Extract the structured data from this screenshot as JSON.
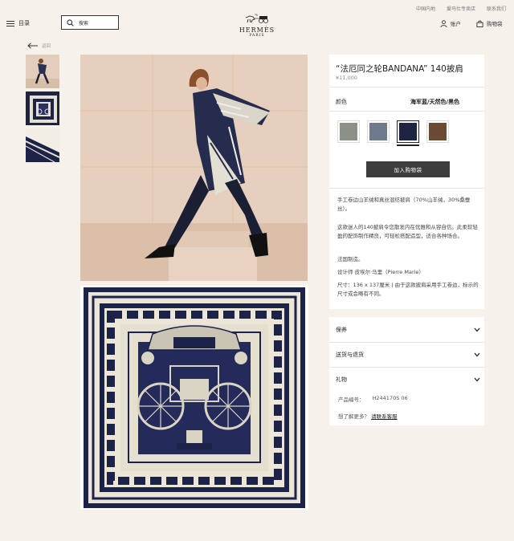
{
  "top_links": [
    "中国内地",
    "爱马仕专卖店",
    "联系我们"
  ],
  "header": {
    "menu_label": "目录",
    "search_placeholder": "搜索",
    "logo_name": "HERMÈS",
    "logo_city": "PARIS",
    "account_label": "账户",
    "cart_label": "购物袋"
  },
  "nav": {
    "back_label": "返回"
  },
  "product": {
    "title": "“法厄同之轮BANDANA” 140披肩",
    "price": "¥11,000",
    "color_label": "颜色",
    "color_value": "海军蓝/天然色/黑色",
    "swatches": [
      {
        "name": "grey-green",
        "color": "#8c9187"
      },
      {
        "name": "blue-grey",
        "color": "#6e7a8c"
      },
      {
        "name": "navy-natural-black",
        "color": "#1f2540"
      },
      {
        "name": "brown",
        "color": "#6b4a34"
      }
    ],
    "add_to_bag": "加入购物袋",
    "description": [
      "手工卷边山羊绒和真丝混纺披肩（70%山羊绒，30%桑蚕丝）。",
      "这款迷人的140披肩令您散发内在优雅和从容自信。此柔软轻盈的配饰制作精良，可轻松搭配造型，适合各种场合。",
      "法国制造。",
      "设计师 皮埃尔·马里（Pierre Marie）",
      "尺寸：136 x 137厘米 | 由于这款披肩采用手工卷边，标示的尺寸或会略有不同。"
    ]
  },
  "accordions": [
    "保养",
    "送货与退货",
    "礼物"
  ],
  "product_number_label": "产品编号：",
  "product_number": "H244170S 06",
  "contact_prefix": "想了解更多？",
  "contact_link": "请联系客服"
}
